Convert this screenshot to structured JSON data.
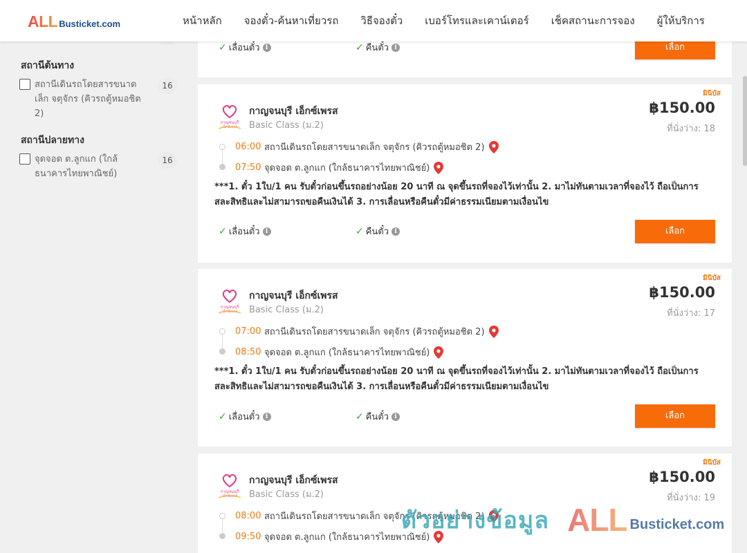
{
  "header": {
    "logo": {
      "all": "ALL",
      "rest": "Busticket.com"
    },
    "nav": [
      {
        "label": "หน้าหลัก"
      },
      {
        "label": "จองตั๋ว-ค้นหาเที่ยวรถ"
      },
      {
        "label": "วิธีจองตั๋ว"
      },
      {
        "label": "เบอร์โทรและเคาน์เตอร์"
      },
      {
        "label": "เช็คสถานะการจอง"
      },
      {
        "label": "ผู้ให้บริการ"
      }
    ]
  },
  "sidebar": {
    "origin": {
      "title": "สถานีต้นทาง",
      "options": [
        {
          "label": "สถานีเดินรถโดยสารขนาดเล็ก จตุจักร (คิวรถตู้หมอชิต 2)",
          "count": "16",
          "checked": false
        }
      ]
    },
    "destination": {
      "title": "สถานีปลายทาง",
      "options": [
        {
          "label": "จุดจอด ต.ลูกแก (ใกล้ธนาคารไทยพาณิชย์)",
          "count": "16",
          "checked": false
        }
      ]
    }
  },
  "labels": {
    "change_ticket": "เลื่อนตั๋ว",
    "refund_ticket": "คืนตั๋ว",
    "select": "เลือก",
    "seats_available": "ที่นั่งว่าง:",
    "info": "i"
  },
  "trips": [
    {
      "tag": "มินิบัส",
      "operator": "กาญจนบุรี เอ็กซ์เพรส",
      "operator_logo_text": "กาญจนบุรี เอ็กซ์เพรส",
      "class": "Basic Class (ม.2)",
      "price": "฿150.00",
      "seats": "18",
      "depart_time": "06:00",
      "depart_station": "สถานีเดินรถโดยสารขนาดเล็ก จตุจักร (คิวรถตู้หมอชิต 2)",
      "arrive_time": "07:50",
      "arrive_station": "จุดจอด ต.ลูกแก (ใกล้ธนาคารไทยพาณิชย์)",
      "note": "***1. ตั๋ว 1ใบ/1 คน รับตั๋วก่อนขึ้นรถอย่างน้อย 20 นาที ณ จุดขึ้นรถที่จองไว้เท่านั้น 2. มาไม่ทันตามเวลาที่จองไว้ ถือเป็นการสละสิทธิและไม่สามารถขอคืนเงินได้ 3. การเลื่อนหรือคืนตั๋วมีค่าธรรมเนียมตามเงื่อนไข"
    },
    {
      "tag": "มินิบัส",
      "operator": "กาญจนบุรี เอ็กซ์เพรส",
      "operator_logo_text": "กาญจนบุรี เอ็กซ์เพรส",
      "class": "Basic Class (ม.2)",
      "price": "฿150.00",
      "seats": "17",
      "depart_time": "07:00",
      "depart_station": "สถานีเดินรถโดยสารขนาดเล็ก จตุจักร (คิวรถตู้หมอชิต 2)",
      "arrive_time": "08:50",
      "arrive_station": "จุดจอด ต.ลูกแก (ใกล้ธนาคารไทยพาณิชย์)",
      "note": "***1. ตั๋ว 1ใบ/1 คน รับตั๋วก่อนขึ้นรถอย่างน้อย 20 นาที ณ จุดขึ้นรถที่จองไว้เท่านั้น 2. มาไม่ทันตามเวลาที่จองไว้ ถือเป็นการสละสิทธิและไม่สามารถขอคืนเงินได้ 3. การเลื่อนหรือคืนตั๋วมีค่าธรรมเนียมตามเงื่อนไข"
    },
    {
      "tag": "มินิบัส",
      "operator": "กาญจนบุรี เอ็กซ์เพรส",
      "operator_logo_text": "กาญจนบุรี เอ็กซ์เพรส",
      "class": "Basic Class (ม.2)",
      "price": "฿150.00",
      "seats": "19",
      "depart_time": "08:00",
      "depart_station": "สถานีเดินรถโดยสารขนาดเล็ก จตุจักร (คิวรถตู้หมอชิต 2)",
      "arrive_time": "09:50",
      "arrive_station": "จุดจอด ต.ลูกแก (ใกล้ธนาคารไทยพาณิชย์)"
    }
  ],
  "watermark": {
    "text": "ตัวอย่างข้อมูล",
    "all": "ALL",
    "rest": "Busticket.com"
  },
  "colors": {
    "accent": "#f86b0b",
    "time": "#f07b12",
    "check": "#3aa53a",
    "pin": "#e53935"
  }
}
